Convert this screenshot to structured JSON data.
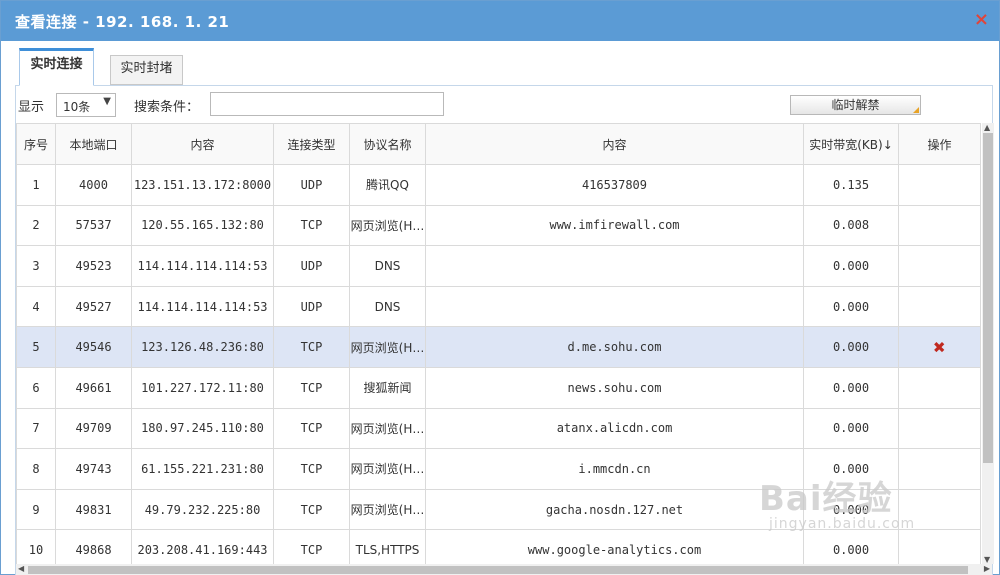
{
  "window": {
    "title": "查看连接 - 192. 168. 1. 21",
    "close_glyph": "×"
  },
  "tabs": [
    {
      "label": "实时连接",
      "active": true
    },
    {
      "label": "实时封堵",
      "active": false
    }
  ],
  "toolbar": {
    "show_label": "显示",
    "page_size": "10条",
    "search_label": "搜索条件：",
    "search_value": "",
    "unban_label": "临时解禁"
  },
  "table": {
    "headers": [
      "序号",
      "本地端口",
      "内容",
      "连接类型",
      "协议名称",
      "内容",
      "实时带宽(KB)↓",
      "操作"
    ],
    "rows": [
      {
        "no": "1",
        "port": "4000",
        "remote": "123.151.13.172:8000",
        "type": "UDP",
        "protocol": "腾讯QQ",
        "content": "416537809",
        "bandwidth": "0.135",
        "action": ""
      },
      {
        "no": "2",
        "port": "57537",
        "remote": "120.55.165.132:80",
        "type": "TCP",
        "protocol": "网页浏览(H…",
        "content": "www.imfirewall.com",
        "bandwidth": "0.008",
        "action": ""
      },
      {
        "no": "3",
        "port": "49523",
        "remote": "114.114.114.114:53",
        "type": "UDP",
        "protocol": "DNS",
        "content": "",
        "bandwidth": "0.000",
        "action": ""
      },
      {
        "no": "4",
        "port": "49527",
        "remote": "114.114.114.114:53",
        "type": "UDP",
        "protocol": "DNS",
        "content": "",
        "bandwidth": "0.000",
        "action": ""
      },
      {
        "no": "5",
        "port": "49546",
        "remote": "123.126.48.236:80",
        "type": "TCP",
        "protocol": "网页浏览(H…",
        "content": "d.me.sohu.com",
        "bandwidth": "0.000",
        "action": "delete",
        "selected": true
      },
      {
        "no": "6",
        "port": "49661",
        "remote": "101.227.172.11:80",
        "type": "TCP",
        "protocol": "搜狐新闻",
        "content": "news.sohu.com",
        "bandwidth": "0.000",
        "action": ""
      },
      {
        "no": "7",
        "port": "49709",
        "remote": "180.97.245.110:80",
        "type": "TCP",
        "protocol": "网页浏览(H…",
        "content": "atanx.alicdn.com",
        "bandwidth": "0.000",
        "action": ""
      },
      {
        "no": "8",
        "port": "49743",
        "remote": "61.155.221.231:80",
        "type": "TCP",
        "protocol": "网页浏览(H…",
        "content": "i.mmcdn.cn",
        "bandwidth": "0.000",
        "action": ""
      },
      {
        "no": "9",
        "port": "49831",
        "remote": "49.79.232.225:80",
        "type": "TCP",
        "protocol": "网页浏览(H…",
        "content": "gacha.nosdn.127.net",
        "bandwidth": "0.000",
        "action": ""
      },
      {
        "no": "10",
        "port": "49868",
        "remote": "203.208.41.169:443",
        "type": "TCP",
        "protocol": "TLS,HTTPS",
        "content": "www.google-analytics.com",
        "bandwidth": "0.000",
        "action": ""
      }
    ]
  },
  "icons": {
    "close": "close-icon",
    "delete": "delete-icon",
    "dropdown": "chevron-down-icon"
  },
  "colors": {
    "titlebar": "#5b9bd5",
    "selected_row": "#dde5f5",
    "delete": "#c0291f",
    "close": "#e0453a"
  },
  "watermark": {
    "brand": "Bai经验",
    "url": "jingyan.baidu.com"
  }
}
